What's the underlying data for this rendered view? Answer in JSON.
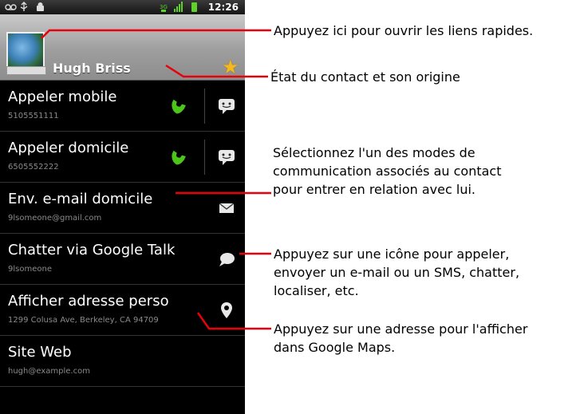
{
  "status_bar": {
    "time": "12:26"
  },
  "contact": {
    "name": "Hugh Briss"
  },
  "rows": [
    {
      "title": "Appeler mobile",
      "subtitle": "5105551111"
    },
    {
      "title": "Appeler domicile",
      "subtitle": "6505552222"
    },
    {
      "title": "Env. e-mail domicile",
      "subtitle": "9lsomeone@gmail.com"
    },
    {
      "title": "Chatter via Google Talk",
      "subtitle": "9lsomeone"
    },
    {
      "title": "Afficher adresse perso",
      "subtitle": "1299 Colusa Ave, Berkeley, CA 94709"
    },
    {
      "title": "Site Web",
      "subtitle": "hugh@example.com"
    }
  ],
  "annotations": {
    "quick_links": "Appuyez ici pour ouvrir les liens rapides.",
    "contact_status": "État du contact et son origine",
    "modes_1": "Sélectionnez l'un des modes de",
    "modes_2": "communication associés au contact",
    "modes_3": "pour entrer en relation avec lui.",
    "icons_1": "Appuyez sur une icône pour appeler,",
    "icons_2": "envoyer un e-mail ou un SMS, chatter,",
    "icons_3": "localiser, etc.",
    "address_1": "Appuyez sur une adresse pour l'afficher",
    "address_2": "dans Google Maps."
  },
  "colors": {
    "callout_line": "#e8000b",
    "call_green": "#4cc51a"
  },
  "icons": [
    "voicemail-icon",
    "usb-icon",
    "android-icon",
    "signal-icon",
    "battery-icon",
    "star-icon",
    "phone-icon",
    "sms-icon",
    "email-icon",
    "chat-icon",
    "map-pin-icon"
  ]
}
